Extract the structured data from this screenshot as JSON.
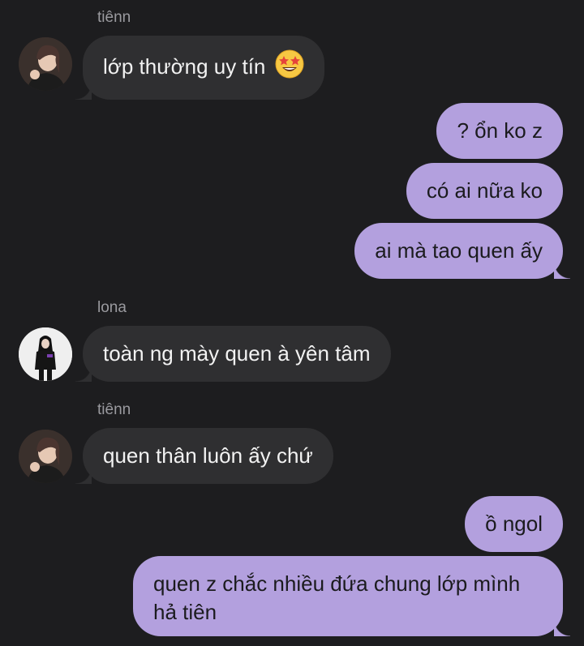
{
  "messages": [
    {
      "sender": "tiênn",
      "text": "lớp thường uy tín",
      "emoji": "star-struck-emoji"
    },
    {
      "sender": "me",
      "text": "? ổn ko z"
    },
    {
      "sender": "me",
      "text": "có ai nữa ko"
    },
    {
      "sender": "me",
      "text": "ai mà tao quen ấy"
    },
    {
      "sender": "lona",
      "text": "toàn ng mày quen à yên tâm"
    },
    {
      "sender": "tiênn",
      "text": "quen thân luôn ấy chứ"
    },
    {
      "sender": "me",
      "text": "ồ ngol"
    },
    {
      "sender": "me",
      "text": "quen z chắc nhiều đứa chung lớp mình hả tiên"
    }
  ],
  "colors": {
    "background": "#1d1d1f",
    "incoming_bubble": "#2f2f31",
    "outgoing_bubble": "#b3a0de",
    "sender_name": "#9a9a9f"
  }
}
